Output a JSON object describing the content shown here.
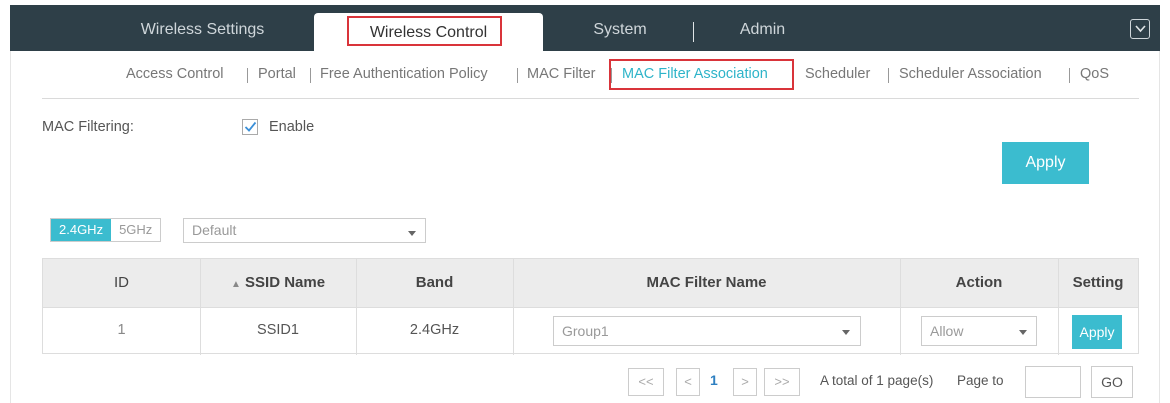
{
  "topnav": {
    "tabs": [
      {
        "label": "Wireless Settings"
      },
      {
        "label": "Wireless Control"
      },
      {
        "label": "System"
      },
      {
        "label": "Admin"
      }
    ]
  },
  "subnav": {
    "items": [
      {
        "label": "Access Control"
      },
      {
        "label": "Portal"
      },
      {
        "label": "Free Authentication Policy"
      },
      {
        "label": "MAC Filter"
      },
      {
        "label": "MAC Filter Association"
      },
      {
        "label": "Scheduler"
      },
      {
        "label": "Scheduler Association"
      },
      {
        "label": "QoS"
      }
    ]
  },
  "mac_filtering": {
    "label": "MAC Filtering:",
    "enable_label": "Enable",
    "apply_label": "Apply"
  },
  "band_toggle": {
    "options": [
      "2.4GHz",
      "5GHz"
    ]
  },
  "site_select": {
    "value": "Default"
  },
  "table": {
    "headers": {
      "id": "ID",
      "ssid": "SSID Name",
      "band": "Band",
      "mac_filter": "MAC Filter Name",
      "action": "Action",
      "setting": "Setting"
    },
    "rows": [
      {
        "id": "1",
        "ssid": "SSID1",
        "band": "2.4GHz",
        "mac_filter": "Group1",
        "action": "Allow",
        "setting": "Apply"
      }
    ]
  },
  "pagination": {
    "first": "<<",
    "prev": "<",
    "current": "1",
    "next": ">",
    "last": ">>",
    "total_text": "A total of 1 page(s)",
    "page_to": "Page to",
    "go": "GO"
  },
  "colors": {
    "nav_bg": "#2e3f48",
    "accent": "#3bbccf",
    "highlight": "#d9343a"
  }
}
